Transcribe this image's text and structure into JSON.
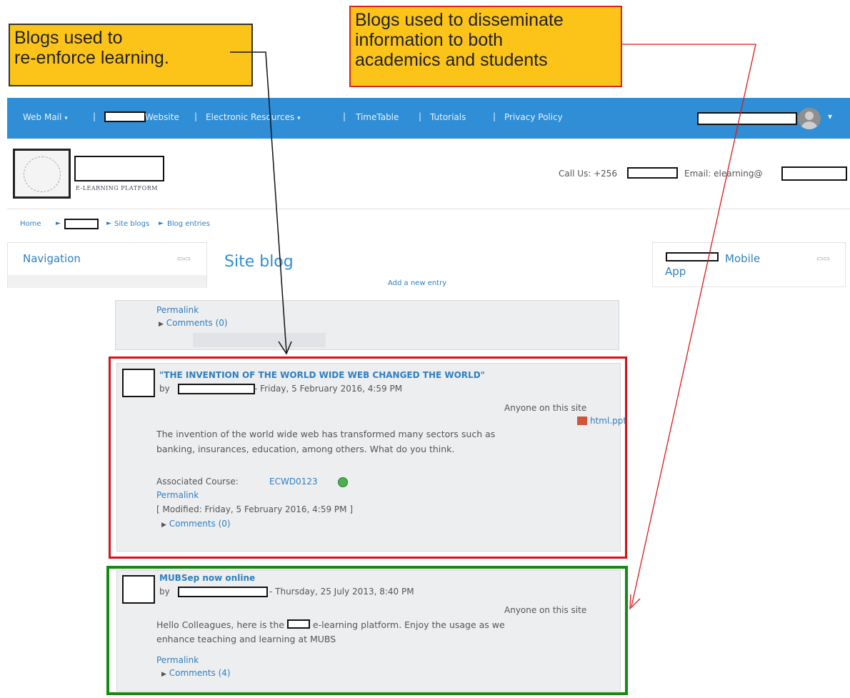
{
  "callouts": {
    "left": [
      "Blogs used to",
      "re-enforce learning."
    ],
    "right": [
      "Blogs used to disseminate",
      "information to both",
      "academics and students"
    ]
  },
  "topnav": {
    "web_mail": "Web Mail",
    "website": "Website",
    "electronic_resources": "Electronic Resources",
    "timetable": "TimeTable",
    "tutorials": "Tutorials",
    "privacy_policy": "Privacy Policy",
    "separator": "|",
    "caret": "▾"
  },
  "header": {
    "platform_label": "E-LEARNING PLATFORM",
    "call_us": "Call Us: +256",
    "email": "Email: elearning@"
  },
  "breadcrumb": [
    "Home",
    "Site blogs",
    "Blog entries"
  ],
  "breadcrumb_sep": "►",
  "navigation_block": {
    "title": "Navigation"
  },
  "mobile_block": {
    "title_part": "Mobile",
    "title_line2": "App"
  },
  "main": {
    "title": "Site blog",
    "add_entry": "Add a new entry"
  },
  "entry0": {
    "permalink": "Permalink",
    "comments": "Comments (0)"
  },
  "entry1": {
    "title": "\"THE INVENTION OF THE WORLD WIDE WEB CHANGED THE WORLD\"",
    "by": "by",
    "date": "- Friday, 5 February 2016, 4:59 PM",
    "visibility": "Anyone on this site",
    "attachment": "html.ppt",
    "body_line1": "The invention of the world wide web has transformed many sectors such as",
    "body_line2": "banking, insurances, education, among others. What do you think.",
    "associated_label": "Associated Course:",
    "course": "ECWD0123",
    "permalink": "Permalink",
    "modified": "[ Modified: Friday, 5 February 2016, 4:59 PM ]",
    "comments": "Comments (0)"
  },
  "entry2": {
    "title": "MUBSep now online",
    "by": "by",
    "date": "- Thursday, 25 July 2013, 8:40 PM",
    "visibility": "Anyone on this site",
    "body_pre": "Hello Colleagues, here is the",
    "body_post": "e-learning platform. Enjoy the usage as we",
    "body_line2": "enhance teaching and learning at MUBS",
    "permalink": "Permalink",
    "comments": "Comments (4)"
  },
  "triangle": "▶",
  "colors": {
    "navbar": "#2f8ed6",
    "link": "#2f7fc0",
    "callout": "#fcc419",
    "frame_red": "#d41414",
    "frame_green": "#138a12"
  }
}
